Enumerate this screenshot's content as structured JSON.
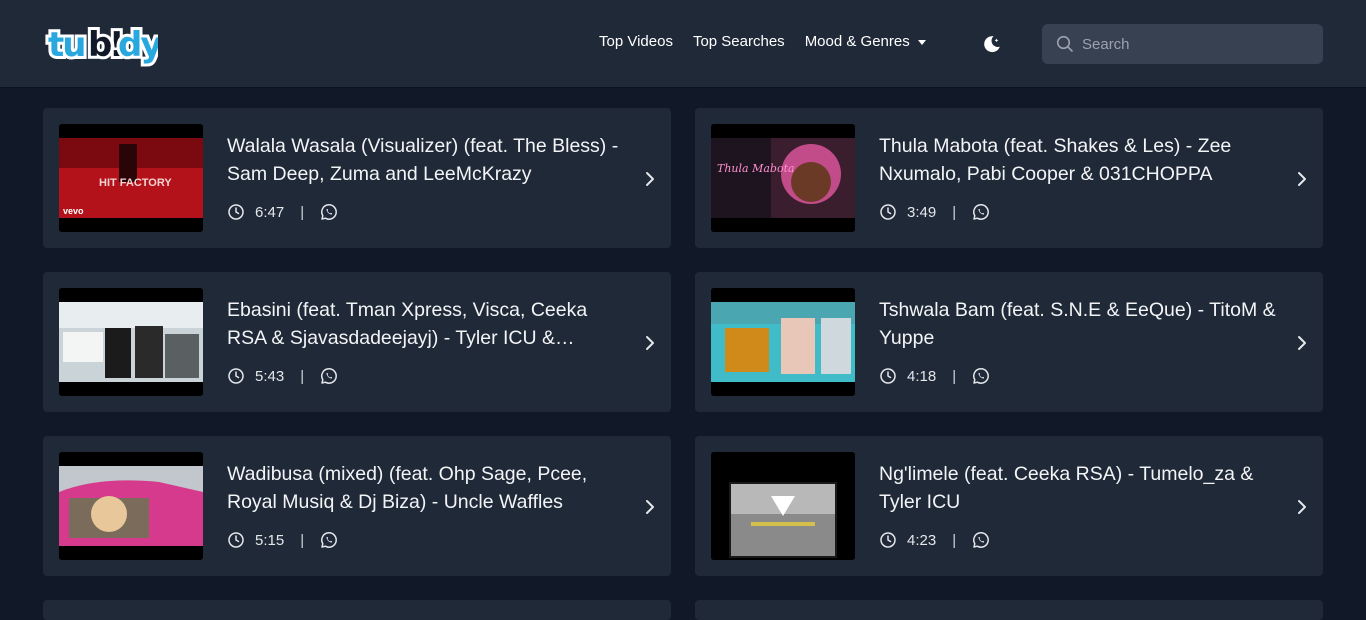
{
  "header": {
    "logo": "tubidy",
    "nav": {
      "top_videos": "Top Videos",
      "top_searches": "Top Searches",
      "mood_genres": "Mood & Genres"
    },
    "search": {
      "placeholder": "Search"
    }
  },
  "videos": [
    {
      "title": "Walala Wasala (Visualizer) (feat. The Bless) - Sam Deep, Zuma and LeeMcKrazy",
      "duration": "6:47",
      "thumb_badge": "vevo",
      "thumb_caption": "HIT FACTORY"
    },
    {
      "title": "Thula Mabota (feat. Shakes & Les) - Zee Nxumalo, Pabi Cooper & 031CHOPPA",
      "duration": "3:49",
      "thumb_caption": "Thula Mabota"
    },
    {
      "title": "Ebasini (feat. Tman Xpress, Visca, Ceeka RSA & Sjavasdadeejayj) - Tyler ICU & Tumelo_za",
      "duration": "5:43"
    },
    {
      "title": "Tshwala Bam (feat. S.N.E & EeQue) - TitoM & Yuppe",
      "duration": "4:18"
    },
    {
      "title": "Wadibusa (mixed) (feat. Ohp Sage, Pcee, Royal Musiq & Dj Biza) - Uncle Waffles",
      "duration": "5:15"
    },
    {
      "title": "Ng'limele (feat. Ceeka RSA) - Tumelo_za & Tyler ICU",
      "duration": "4:23"
    }
  ],
  "colors": {
    "background": "#111827",
    "card": "#1f2937",
    "header": "#1f2937",
    "search_bg": "#374151",
    "logo_blue": "#29a8df"
  },
  "icons": {
    "theme": "moon-icon",
    "search": "search-icon",
    "duration": "clock-icon",
    "share": "whatsapp-icon",
    "open": "chevron-right-icon"
  }
}
